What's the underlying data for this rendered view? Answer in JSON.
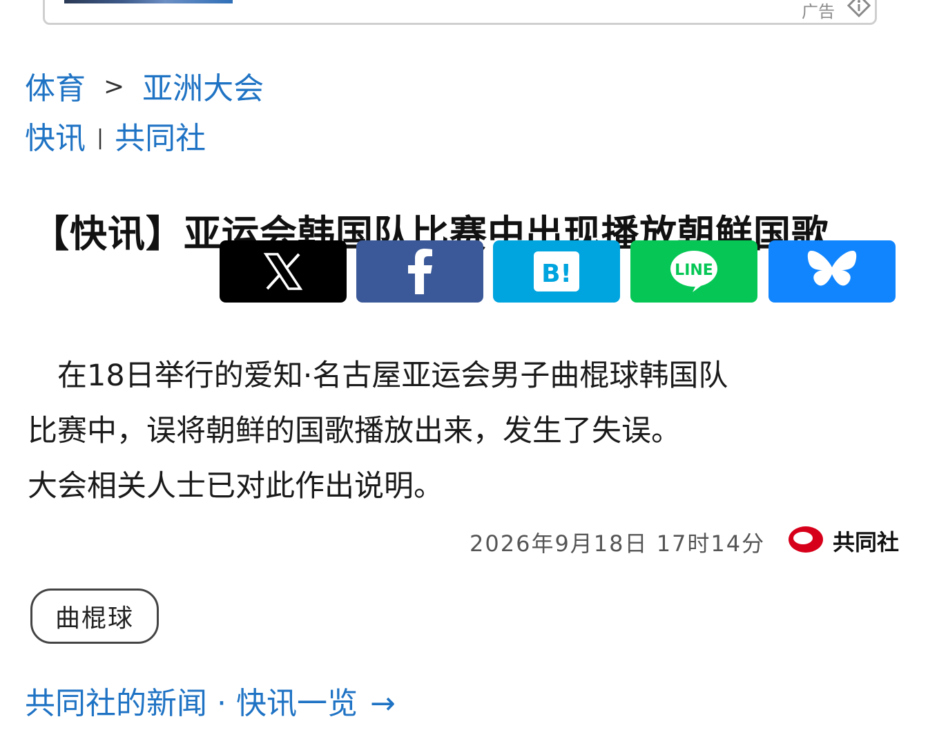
{
  "ad": {
    "label": "广告",
    "info_icon": "info-diamond-icon"
  },
  "breadcrumb": {
    "section": "体育",
    "separator": ">",
    "subsection": "亚洲大会"
  },
  "category": {
    "type": "快讯",
    "divider": "|",
    "source": "共同社"
  },
  "headline": "【快讯】亚运会韩国队比赛中出现播放朝鲜国歌",
  "share_buttons": [
    {
      "name": "x",
      "icon": "x-logo-icon",
      "color": "#000000"
    },
    {
      "name": "facebook",
      "icon": "facebook-f-icon",
      "color": "#3b5998"
    },
    {
      "name": "hatena",
      "icon": "hatena-bookmark-icon",
      "text": "B!",
      "color": "#00a4de"
    },
    {
      "name": "line",
      "icon": "line-logo-icon",
      "text": "LINE",
      "color": "#06c755"
    },
    {
      "name": "bluesky",
      "icon": "bluesky-butterfly-icon",
      "color": "#1185fe"
    }
  ],
  "body": {
    "line1": "　在18日举行的爱知·名古屋亚运会男子曲棍球韩国队",
    "line2": "比赛中，误将朝鲜的国歌播放出来，发生了失误。",
    "line3": "大会相关人士已对此作出说明。"
  },
  "dateline": "2026年9月18日 17时14分",
  "source": {
    "name": "共同社",
    "logo": "kyodo-logo-icon"
  },
  "tag": "曲棍球",
  "more_link": {
    "label": "共同社的新闻 · 快讯一览",
    "arrow": "→"
  },
  "colors": {
    "link": "#1f73c4",
    "kyodo_red": "#d7001a"
  }
}
